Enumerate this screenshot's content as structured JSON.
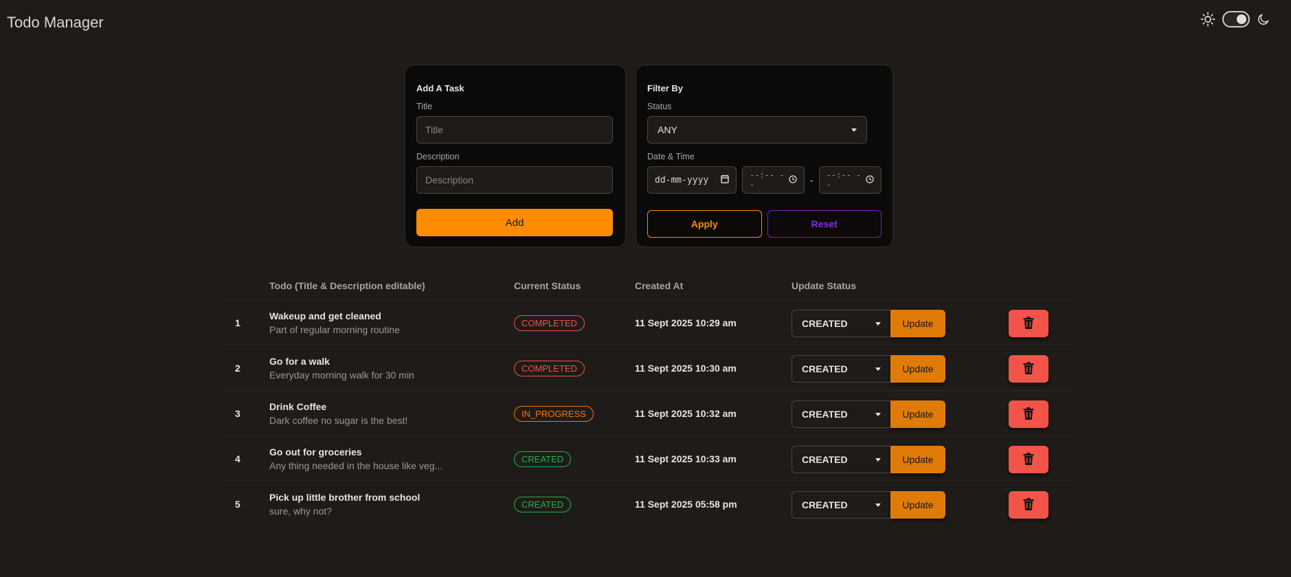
{
  "app": {
    "title": "Todo Manager"
  },
  "theme": {
    "mode": "dark",
    "sun_icon": "sun-icon",
    "moon_icon": "moon-icon"
  },
  "add_task": {
    "heading": "Add A Task",
    "title_label": "Title",
    "title_placeholder": "Title",
    "title_value": "",
    "description_label": "Description",
    "description_placeholder": "Description",
    "description_value": "",
    "add_label": "Add"
  },
  "filter": {
    "heading": "Filter By",
    "status_label": "Status",
    "status_value": "ANY",
    "datetime_label": "Date & Time",
    "date_placeholder": "dd-mm-yyyy",
    "time_from_placeholder": "--:-- --",
    "separator": "-",
    "time_to_placeholder": "--:-- --",
    "apply_label": "Apply",
    "reset_label": "Reset"
  },
  "table": {
    "headers": {
      "todo": "Todo (Title & Description editable)",
      "current_status": "Current Status",
      "created_at": "Created At",
      "update_status": "Update Status"
    },
    "update_button_label": "Update",
    "status_colors": {
      "COMPLETED": "#f25449",
      "IN_PROGRESS": "#f07a16",
      "CREATED": "#22b24c"
    },
    "rows": [
      {
        "num": "1",
        "title": "Wakeup and get cleaned",
        "description": "Part of regular morning routine",
        "status": "COMPLETED",
        "created_at": "11 Sept 2025 10:29 am",
        "update_value": "CREATED"
      },
      {
        "num": "2",
        "title": "Go for a walk",
        "description": "Everyday morning walk for 30 min",
        "status": "COMPLETED",
        "created_at": "11 Sept 2025 10:30 am",
        "update_value": "CREATED"
      },
      {
        "num": "3",
        "title": "Drink Coffee",
        "description": "Dark coffee no sugar is the best!",
        "status": "IN_PROGRESS",
        "created_at": "11 Sept 2025 10:32 am",
        "update_value": "CREATED"
      },
      {
        "num": "4",
        "title": "Go out for groceries",
        "description": "Any thing needed in the house like veg...",
        "status": "CREATED",
        "created_at": "11 Sept 2025 10:33 am",
        "update_value": "CREATED"
      },
      {
        "num": "5",
        "title": "Pick up little brother from school",
        "description": "sure, why not?",
        "status": "CREATED",
        "created_at": "11 Sept 2025 05:58 pm",
        "update_value": "CREATED"
      }
    ]
  }
}
